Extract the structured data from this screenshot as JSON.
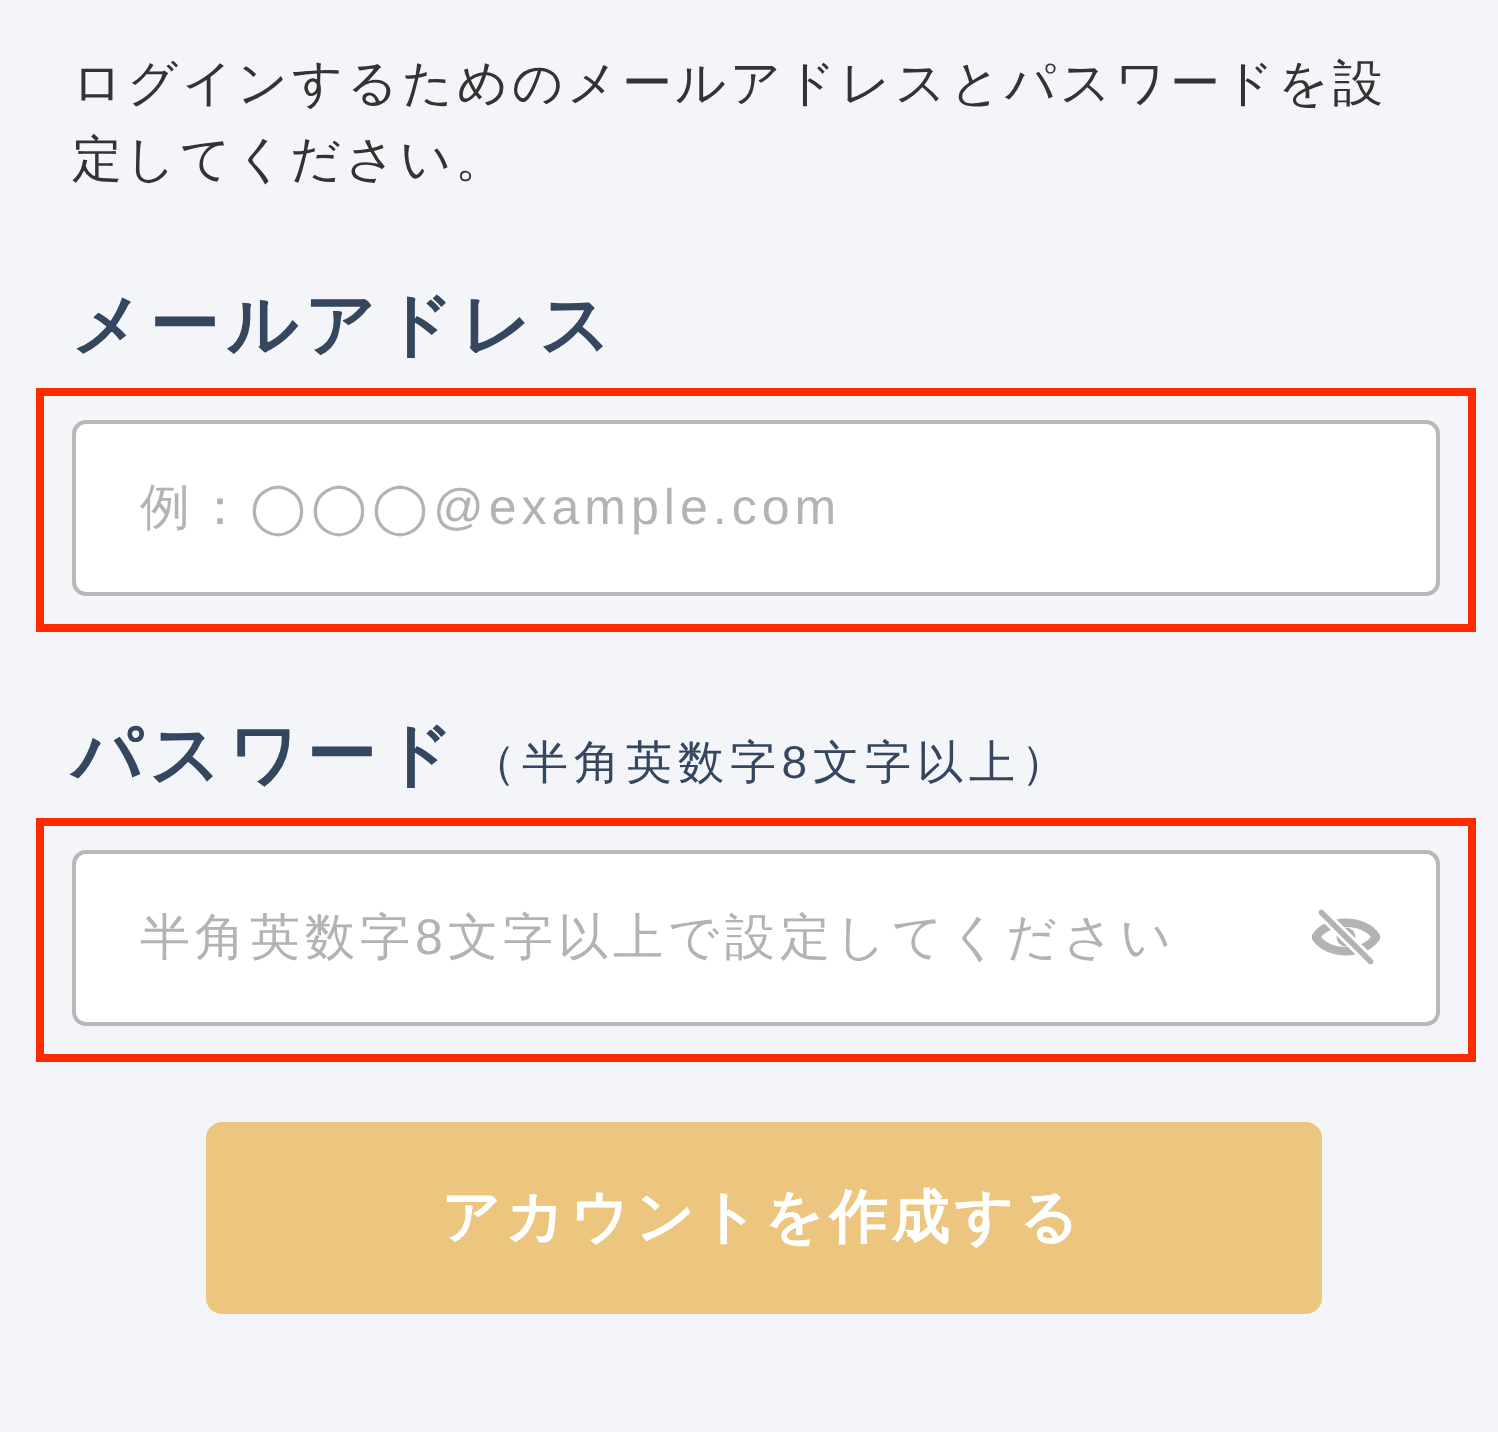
{
  "intro": "ログインするためのメールアドレスとパスワードを設定してください。",
  "fields": [
    {
      "kind": "email",
      "label": "メールアドレス",
      "placeholder": "例：◯◯◯@example.com",
      "highlighted": true
    },
    {
      "kind": "password",
      "label": "パスワード",
      "hint": "（半角英数字8文字以上）",
      "placeholder": "半角英数字8文字以上で設定してください",
      "highlighted": true,
      "password_visible": false
    }
  ],
  "submit_button": {
    "label": "アカウントを作成する"
  }
}
